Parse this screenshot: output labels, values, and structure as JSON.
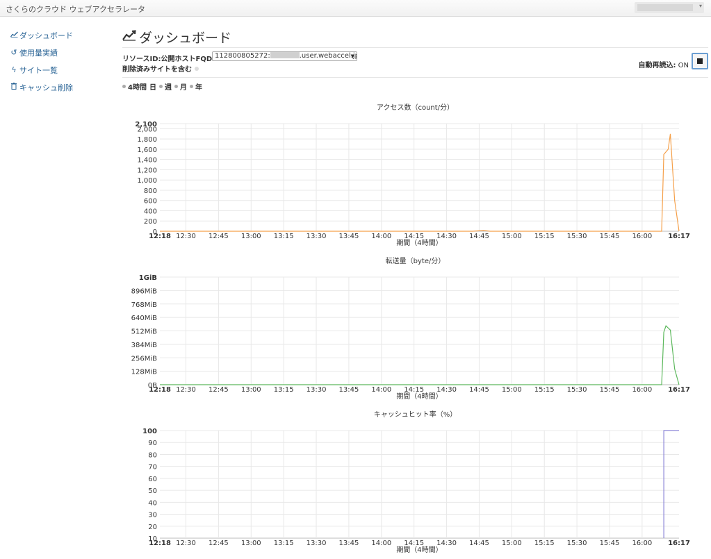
{
  "app": {
    "brand": "さくらのクラウド ウェブアクセラレータ",
    "user_caret": "▾"
  },
  "sidebar": {
    "items": [
      {
        "label": "ダッシュボード",
        "icon": "chart-line-icon"
      },
      {
        "label": "使用量実績",
        "icon": "history-icon"
      },
      {
        "label": "サイト一覧",
        "icon": "bolt-icon"
      },
      {
        "label": "キャッシュ削除",
        "icon": "trash-icon"
      }
    ]
  },
  "main": {
    "title": "ダッシュボード",
    "resource_label": "リソースID:公開ホストFQDN",
    "fqdn_prefix": "112800805272:",
    "fqdn_suffix": ".user.webaccel.jp",
    "include_deleted_label": "削除済みサイトを含む",
    "auto_reload_label": "自動再読込:",
    "auto_reload_state": "ON",
    "periods": [
      "4時間",
      "日",
      "週",
      "月",
      "年"
    ],
    "selected_period": "4時間"
  },
  "chart_data": [
    {
      "type": "line",
      "title": "アクセス数（count/分）",
      "xlabel": "期間（4時間）",
      "color": "#f5a04a",
      "x_ticks": [
        "12:18",
        "12:30",
        "12:45",
        "13:00",
        "13:15",
        "13:30",
        "13:45",
        "14:00",
        "14:15",
        "14:30",
        "14:45",
        "15:00",
        "15:15",
        "15:30",
        "15:45",
        "16:00",
        "16:17"
      ],
      "y_ticks": [
        "0",
        "200",
        "400",
        "600",
        "800",
        "1,000",
        "1,200",
        "1,400",
        "1,600",
        "1,800",
        "2,000",
        "2,100"
      ],
      "ylim": [
        0,
        2100
      ],
      "series": [
        {
          "points": [
            [
              "12:18",
              0
            ],
            [
              "14:42",
              0
            ],
            [
              "14:47",
              15
            ],
            [
              "14:50",
              0
            ],
            [
              "16:09",
              0
            ],
            [
              "16:10",
              1500
            ],
            [
              "16:12",
              1600
            ],
            [
              "16:13",
              1900
            ],
            [
              "16:15",
              600
            ],
            [
              "16:17",
              0
            ]
          ]
        }
      ]
    },
    {
      "type": "line",
      "title": "転送量（byte/分）",
      "xlabel": "期間（4時間）",
      "color": "#5cb85c",
      "x_ticks": [
        "12:18",
        "12:30",
        "12:45",
        "13:00",
        "13:15",
        "13:30",
        "13:45",
        "14:00",
        "14:15",
        "14:30",
        "14:45",
        "15:00",
        "15:15",
        "15:30",
        "15:45",
        "16:00",
        "16:17"
      ],
      "y_ticks": [
        "0B",
        "128MiB",
        "256MiB",
        "384MiB",
        "512MiB",
        "640MiB",
        "768MiB",
        "896MiB",
        "1GiB"
      ],
      "ylim": [
        0,
        1024
      ],
      "series": [
        {
          "points": [
            [
              "12:18",
              0
            ],
            [
              "16:09",
              0
            ],
            [
              "16:10",
              500
            ],
            [
              "16:11",
              560
            ],
            [
              "16:13",
              520
            ],
            [
              "16:15",
              150
            ],
            [
              "16:17",
              0
            ]
          ]
        }
      ]
    },
    {
      "type": "line",
      "title": "キャッシュヒット率（%）",
      "xlabel": "期間（4時間）",
      "color": "#8b84d7",
      "x_ticks": [
        "12:18",
        "12:30",
        "12:45",
        "13:00",
        "13:15",
        "13:30",
        "13:45",
        "14:00",
        "14:15",
        "14:30",
        "14:45",
        "15:00",
        "15:15",
        "15:30",
        "15:45",
        "16:00",
        "16:17"
      ],
      "y_ticks": [
        "10",
        "20",
        "30",
        "40",
        "50",
        "60",
        "70",
        "80",
        "90",
        "100"
      ],
      "ylim": [
        10,
        100
      ],
      "series": [
        {
          "points": [
            [
              "16:10",
              10
            ],
            [
              "16:10",
              100
            ],
            [
              "16:17",
              100
            ]
          ]
        }
      ]
    }
  ]
}
